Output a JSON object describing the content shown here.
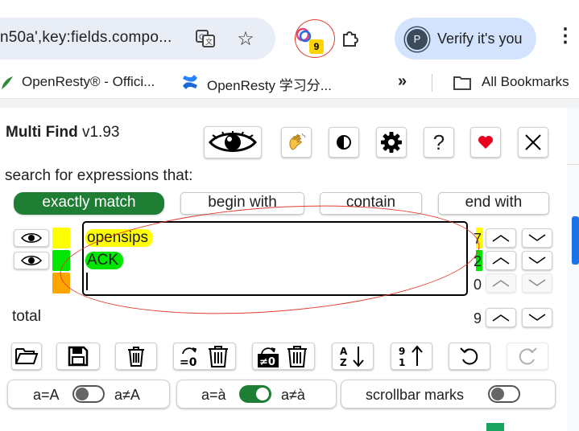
{
  "browser": {
    "url_text": "n50a',key:fields.compo...",
    "extension_badge": "9",
    "verify_label": "Verify it's you",
    "avatar_letter": "P",
    "bookmarks": [
      "OpenResty® - Offici...",
      "OpenResty 学习分...",
      "All Bookmarks"
    ],
    "overflow": "»"
  },
  "popup": {
    "title_bold": "Multi Find",
    "title_version": "v1.93",
    "search_label": "search for expressions that:",
    "modes": [
      {
        "label": "exactly match",
        "active": true
      },
      {
        "label": "begin with",
        "active": false
      },
      {
        "label": "contain",
        "active": false
      },
      {
        "label": "end with",
        "active": false
      }
    ],
    "terms": [
      {
        "text": "opensips",
        "color": "#ffff00",
        "count": "7"
      },
      {
        "text": "ACK",
        "color": "#00e600",
        "count": "2"
      },
      {
        "text": "",
        "color": "#ffa500",
        "count": "0"
      }
    ],
    "total_label": "total",
    "total_count": "9",
    "toggles": {
      "case": {
        "left": "a=A",
        "right": "a≠A",
        "on": false
      },
      "accent": {
        "left": "a=à",
        "right": "a≠à",
        "on": true
      },
      "scrollbar": {
        "label": "scrollbar marks",
        "on": false
      }
    },
    "help_glyph": "?"
  },
  "colors": {
    "accent_green": "#1e7e34",
    "annotation_red": "#e23b2e"
  }
}
